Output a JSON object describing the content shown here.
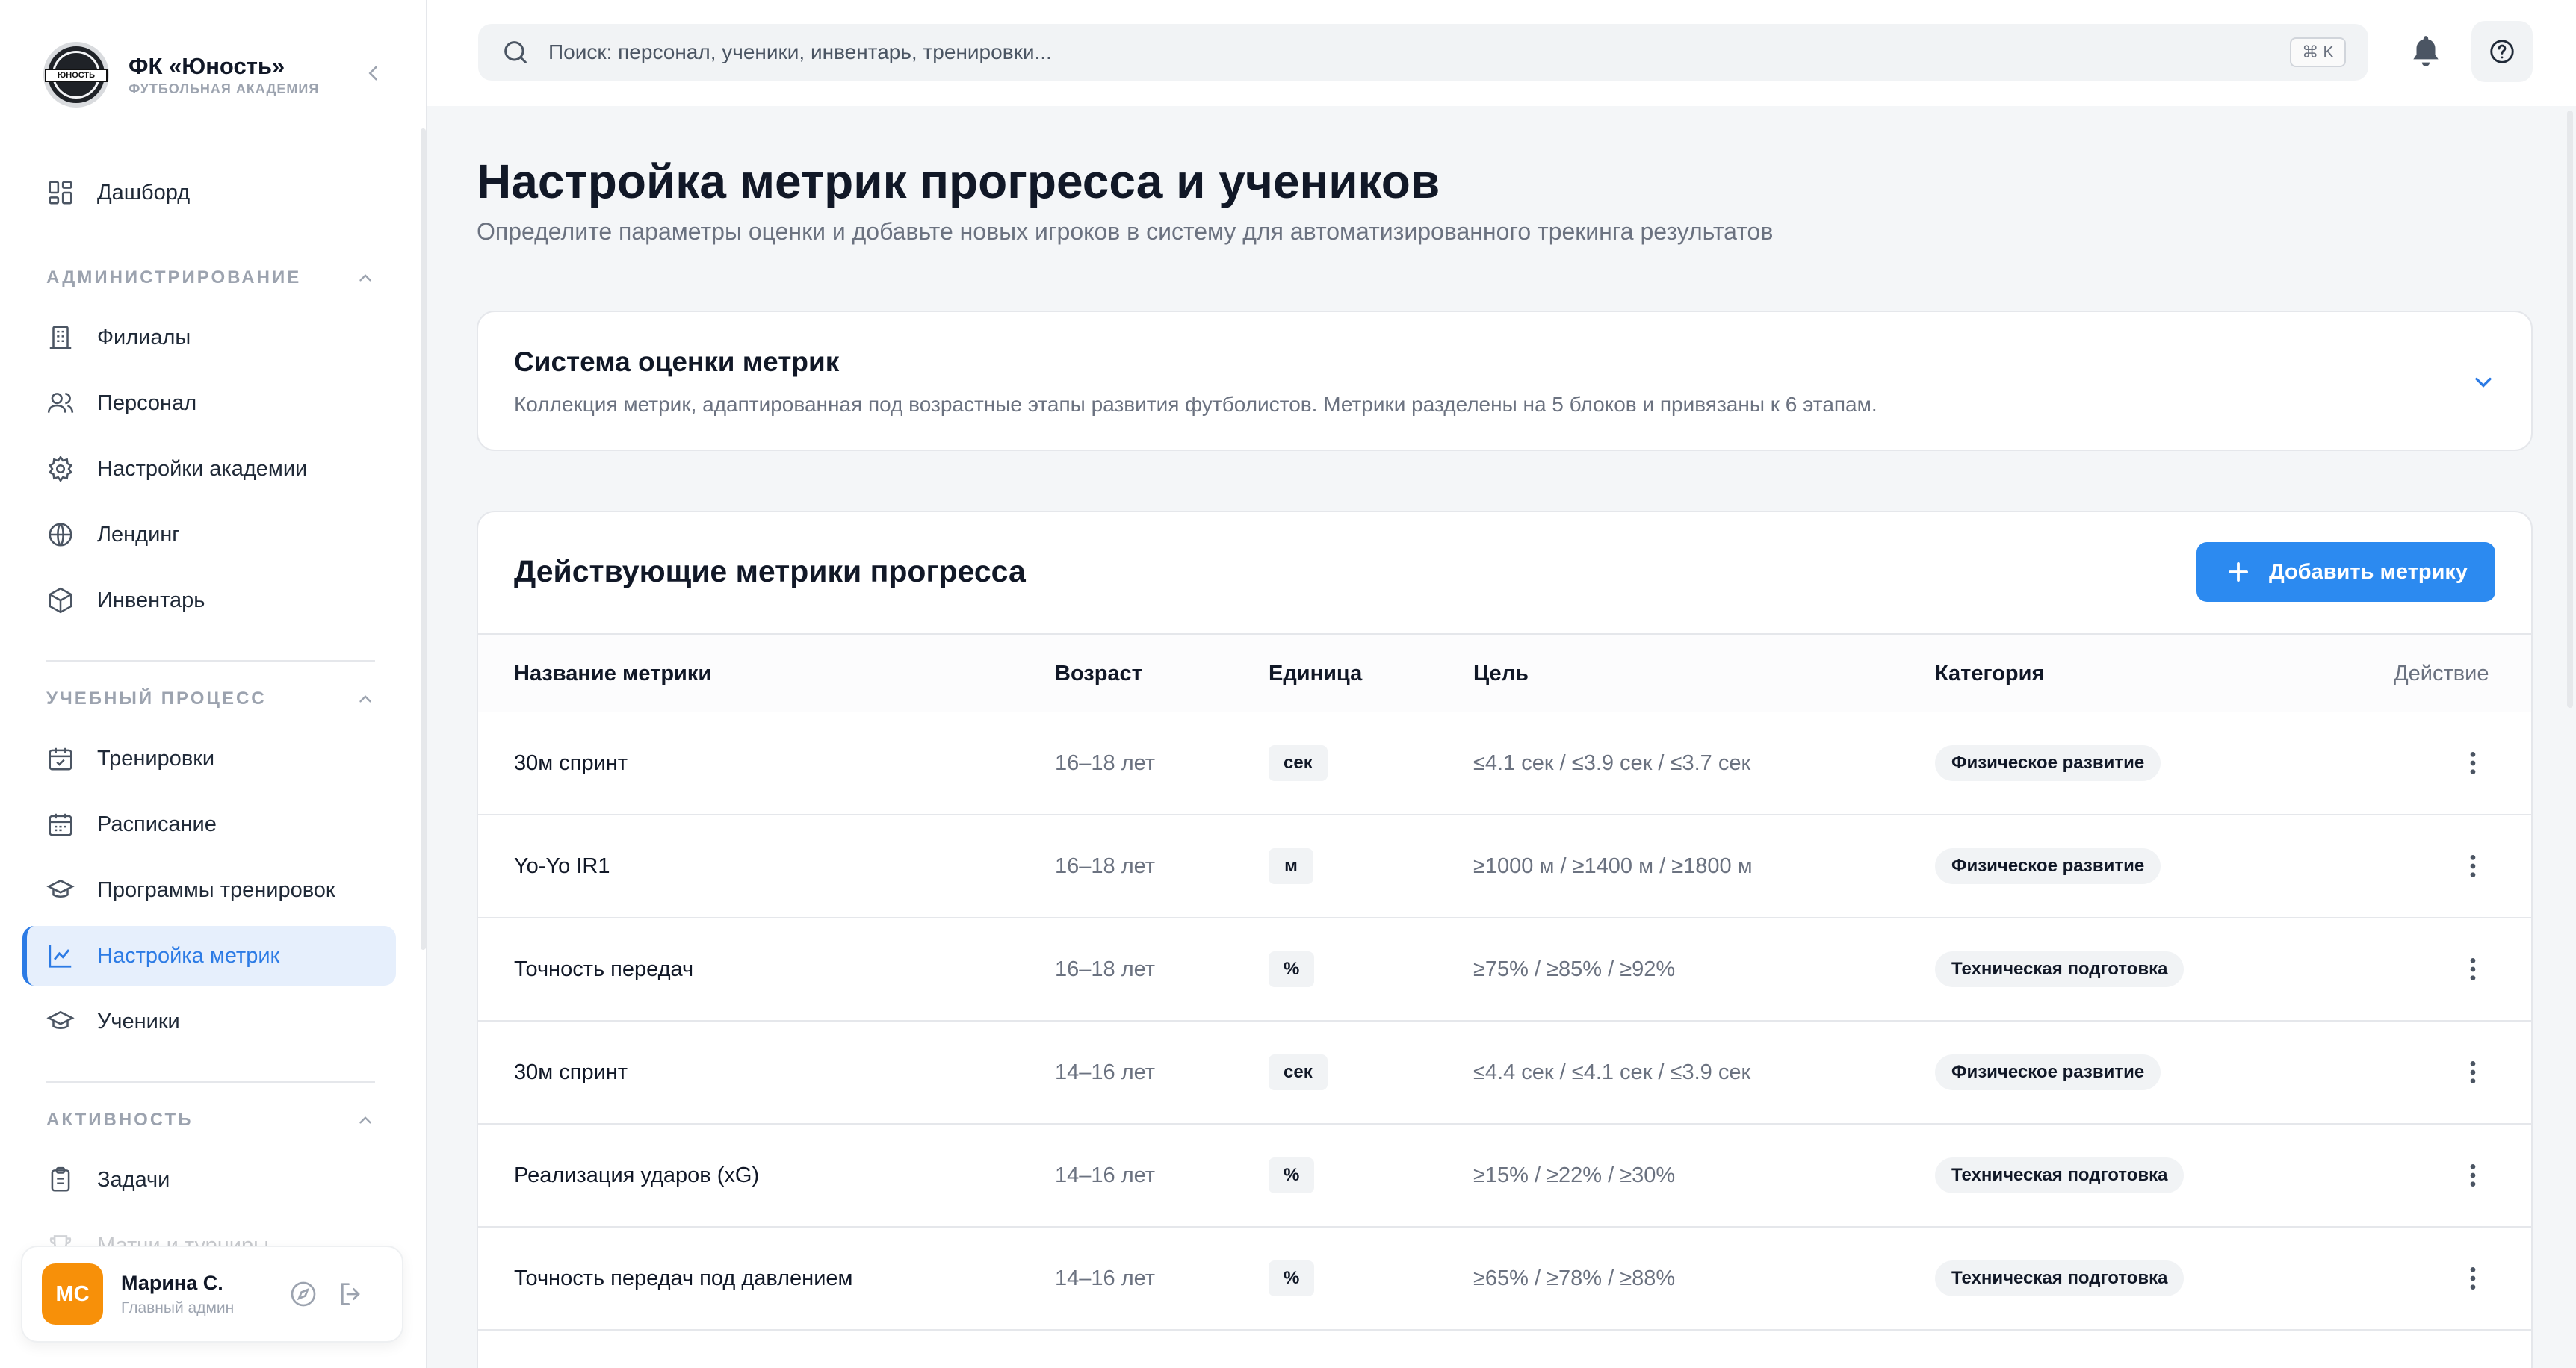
{
  "brand": {
    "title": "ФК «Юность»",
    "subtitle": "ФУТБОЛЬНАЯ АКАДЕМИЯ",
    "logo_text": "ЮНОСТЬ"
  },
  "sidebar": {
    "dashboard": "Дашборд",
    "sections": [
      {
        "title": "АДМИНИСТРИРОВАНИЕ",
        "items": [
          "Филиалы",
          "Персонал",
          "Настройки академии",
          "Лендинг",
          "Инвентарь"
        ]
      },
      {
        "title": "УЧЕБНЫЙ ПРОЦЕСС",
        "items": [
          "Тренировки",
          "Расписание",
          "Программы тренировок",
          "Настройка метрик",
          "Ученики"
        ]
      },
      {
        "title": "АКТИВНОСТЬ",
        "items": [
          "Задачи",
          "Матчи и турниры"
        ]
      }
    ],
    "active_item": "Настройка метрик"
  },
  "user": {
    "initials": "МС",
    "name": "Марина С.",
    "role": "Главный админ"
  },
  "search": {
    "placeholder": "Поиск: персонал, ученики, инвентарь, тренировки...",
    "shortcut": "⌘ K"
  },
  "page": {
    "title": "Настройка метрик прогресса и учеников",
    "subtitle": "Определите параметры оценки и добавьте новых игроков в систему для автоматизированного трекинга результатов"
  },
  "evaluation_card": {
    "title": "Система оценки метрик",
    "description": "Коллекция метрик, адаптированная под возрастные этапы развития футболистов. Метрики разделены на 5 блоков и привязаны к 6 этапам."
  },
  "metrics_table": {
    "title": "Действующие метрики прогресса",
    "add_button": "Добавить метрику",
    "columns": [
      "Название метрики",
      "Возраст",
      "Единица",
      "Цель",
      "Категория",
      "Действие"
    ],
    "rows": [
      {
        "name": "30м спринт",
        "age": "16–18 лет",
        "unit": "сек",
        "goal": "≤4.1 сек / ≤3.9 сек / ≤3.7 сек",
        "category": "Физическое развитие"
      },
      {
        "name": "Yo-Yo IR1",
        "age": "16–18 лет",
        "unit": "м",
        "goal": "≥1000 м / ≥1400 м / ≥1800 м",
        "category": "Физическое развитие"
      },
      {
        "name": "Точность передач",
        "age": "16–18 лет",
        "unit": "%",
        "goal": "≥75% / ≥85% / ≥92%",
        "category": "Техническая подготовка"
      },
      {
        "name": "30м спринт",
        "age": "14–16 лет",
        "unit": "сек",
        "goal": "≤4.4 сек / ≤4.1 сек / ≤3.9 сек",
        "category": "Физическое развитие"
      },
      {
        "name": "Реализация ударов (xG)",
        "age": "14–16 лет",
        "unit": "%",
        "goal": "≥15% / ≥22% / ≥30%",
        "category": "Техническая подготовка"
      },
      {
        "name": "Точность передач под давлением",
        "age": "14–16 лет",
        "unit": "%",
        "goal": "≥65% / ≥78% / ≥88%",
        "category": "Техническая подготовка"
      }
    ]
  },
  "colors": {
    "accent": "#2c8af0",
    "active_bg": "#e6effc",
    "avatar": "#f79009"
  }
}
